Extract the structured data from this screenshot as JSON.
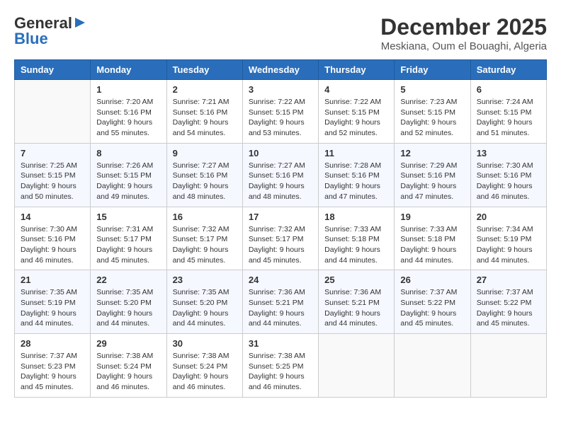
{
  "header": {
    "logo_general": "General",
    "logo_blue": "Blue",
    "month_title": "December 2025",
    "location": "Meskiana, Oum el Bouaghi, Algeria"
  },
  "weekdays": [
    "Sunday",
    "Monday",
    "Tuesday",
    "Wednesday",
    "Thursday",
    "Friday",
    "Saturday"
  ],
  "weeks": [
    [
      {
        "day": "",
        "info": ""
      },
      {
        "day": "1",
        "info": "Sunrise: 7:20 AM\nSunset: 5:16 PM\nDaylight: 9 hours\nand 55 minutes."
      },
      {
        "day": "2",
        "info": "Sunrise: 7:21 AM\nSunset: 5:16 PM\nDaylight: 9 hours\nand 54 minutes."
      },
      {
        "day": "3",
        "info": "Sunrise: 7:22 AM\nSunset: 5:15 PM\nDaylight: 9 hours\nand 53 minutes."
      },
      {
        "day": "4",
        "info": "Sunrise: 7:22 AM\nSunset: 5:15 PM\nDaylight: 9 hours\nand 52 minutes."
      },
      {
        "day": "5",
        "info": "Sunrise: 7:23 AM\nSunset: 5:15 PM\nDaylight: 9 hours\nand 52 minutes."
      },
      {
        "day": "6",
        "info": "Sunrise: 7:24 AM\nSunset: 5:15 PM\nDaylight: 9 hours\nand 51 minutes."
      }
    ],
    [
      {
        "day": "7",
        "info": "Sunrise: 7:25 AM\nSunset: 5:15 PM\nDaylight: 9 hours\nand 50 minutes."
      },
      {
        "day": "8",
        "info": "Sunrise: 7:26 AM\nSunset: 5:15 PM\nDaylight: 9 hours\nand 49 minutes."
      },
      {
        "day": "9",
        "info": "Sunrise: 7:27 AM\nSunset: 5:16 PM\nDaylight: 9 hours\nand 48 minutes."
      },
      {
        "day": "10",
        "info": "Sunrise: 7:27 AM\nSunset: 5:16 PM\nDaylight: 9 hours\nand 48 minutes."
      },
      {
        "day": "11",
        "info": "Sunrise: 7:28 AM\nSunset: 5:16 PM\nDaylight: 9 hours\nand 47 minutes."
      },
      {
        "day": "12",
        "info": "Sunrise: 7:29 AM\nSunset: 5:16 PM\nDaylight: 9 hours\nand 47 minutes."
      },
      {
        "day": "13",
        "info": "Sunrise: 7:30 AM\nSunset: 5:16 PM\nDaylight: 9 hours\nand 46 minutes."
      }
    ],
    [
      {
        "day": "14",
        "info": "Sunrise: 7:30 AM\nSunset: 5:16 PM\nDaylight: 9 hours\nand 46 minutes."
      },
      {
        "day": "15",
        "info": "Sunrise: 7:31 AM\nSunset: 5:17 PM\nDaylight: 9 hours\nand 45 minutes."
      },
      {
        "day": "16",
        "info": "Sunrise: 7:32 AM\nSunset: 5:17 PM\nDaylight: 9 hours\nand 45 minutes."
      },
      {
        "day": "17",
        "info": "Sunrise: 7:32 AM\nSunset: 5:17 PM\nDaylight: 9 hours\nand 45 minutes."
      },
      {
        "day": "18",
        "info": "Sunrise: 7:33 AM\nSunset: 5:18 PM\nDaylight: 9 hours\nand 44 minutes."
      },
      {
        "day": "19",
        "info": "Sunrise: 7:33 AM\nSunset: 5:18 PM\nDaylight: 9 hours\nand 44 minutes."
      },
      {
        "day": "20",
        "info": "Sunrise: 7:34 AM\nSunset: 5:19 PM\nDaylight: 9 hours\nand 44 minutes."
      }
    ],
    [
      {
        "day": "21",
        "info": "Sunrise: 7:35 AM\nSunset: 5:19 PM\nDaylight: 9 hours\nand 44 minutes."
      },
      {
        "day": "22",
        "info": "Sunrise: 7:35 AM\nSunset: 5:20 PM\nDaylight: 9 hours\nand 44 minutes."
      },
      {
        "day": "23",
        "info": "Sunrise: 7:35 AM\nSunset: 5:20 PM\nDaylight: 9 hours\nand 44 minutes."
      },
      {
        "day": "24",
        "info": "Sunrise: 7:36 AM\nSunset: 5:21 PM\nDaylight: 9 hours\nand 44 minutes."
      },
      {
        "day": "25",
        "info": "Sunrise: 7:36 AM\nSunset: 5:21 PM\nDaylight: 9 hours\nand 44 minutes."
      },
      {
        "day": "26",
        "info": "Sunrise: 7:37 AM\nSunset: 5:22 PM\nDaylight: 9 hours\nand 45 minutes."
      },
      {
        "day": "27",
        "info": "Sunrise: 7:37 AM\nSunset: 5:22 PM\nDaylight: 9 hours\nand 45 minutes."
      }
    ],
    [
      {
        "day": "28",
        "info": "Sunrise: 7:37 AM\nSunset: 5:23 PM\nDaylight: 9 hours\nand 45 minutes."
      },
      {
        "day": "29",
        "info": "Sunrise: 7:38 AM\nSunset: 5:24 PM\nDaylight: 9 hours\nand 46 minutes."
      },
      {
        "day": "30",
        "info": "Sunrise: 7:38 AM\nSunset: 5:24 PM\nDaylight: 9 hours\nand 46 minutes."
      },
      {
        "day": "31",
        "info": "Sunrise: 7:38 AM\nSunset: 5:25 PM\nDaylight: 9 hours\nand 46 minutes."
      },
      {
        "day": "",
        "info": ""
      },
      {
        "day": "",
        "info": ""
      },
      {
        "day": "",
        "info": ""
      }
    ]
  ]
}
